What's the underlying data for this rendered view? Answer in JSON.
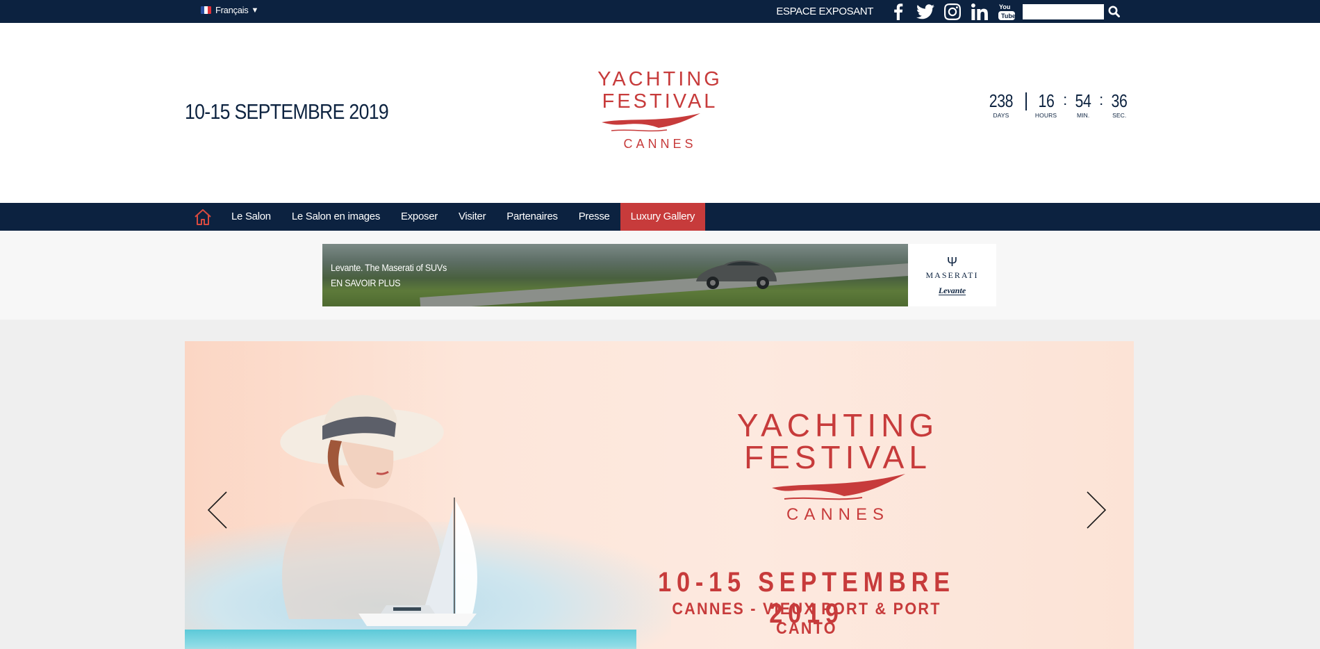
{
  "topbar": {
    "language": "Français",
    "exhibitor_link": "ESPACE EXPOSANT",
    "social": [
      "facebook-icon",
      "twitter-icon",
      "instagram-icon",
      "linkedin-icon",
      "youtube-icon"
    ],
    "search_placeholder": ""
  },
  "header": {
    "dates": "10-15 SEPTEMBRE 2019",
    "logo": {
      "line1": "YACHTING",
      "line2": "FESTIVAL",
      "line3": "CANNES"
    },
    "countdown": {
      "days": "238",
      "days_label": "DAYS",
      "hours": "16",
      "hours_label": "HOURS",
      "minutes": "54",
      "minutes_label": "MIN.",
      "seconds": "36",
      "seconds_label": "SEC."
    }
  },
  "nav": {
    "items": [
      "Le Salon",
      "Le Salon en images",
      "Exposer",
      "Visiter",
      "Partenaires",
      "Presse",
      "Luxury Gallery"
    ]
  },
  "ad": {
    "line1": "Levante. The Maserati of SUVs",
    "line2": "EN SAVOIR PLUS",
    "brand": "MASERATI",
    "model": "Levante"
  },
  "hero": {
    "logo": {
      "line1": "YACHTING",
      "line2": "FESTIVAL",
      "line3": "CANNES"
    },
    "dates": "10-15 SEPTEMBRE 2019",
    "venue": "CANNES - VIEUX PORT & PORT CANTO"
  },
  "colors": {
    "navy": "#0c2240",
    "brand_red": "#c73b3b"
  }
}
